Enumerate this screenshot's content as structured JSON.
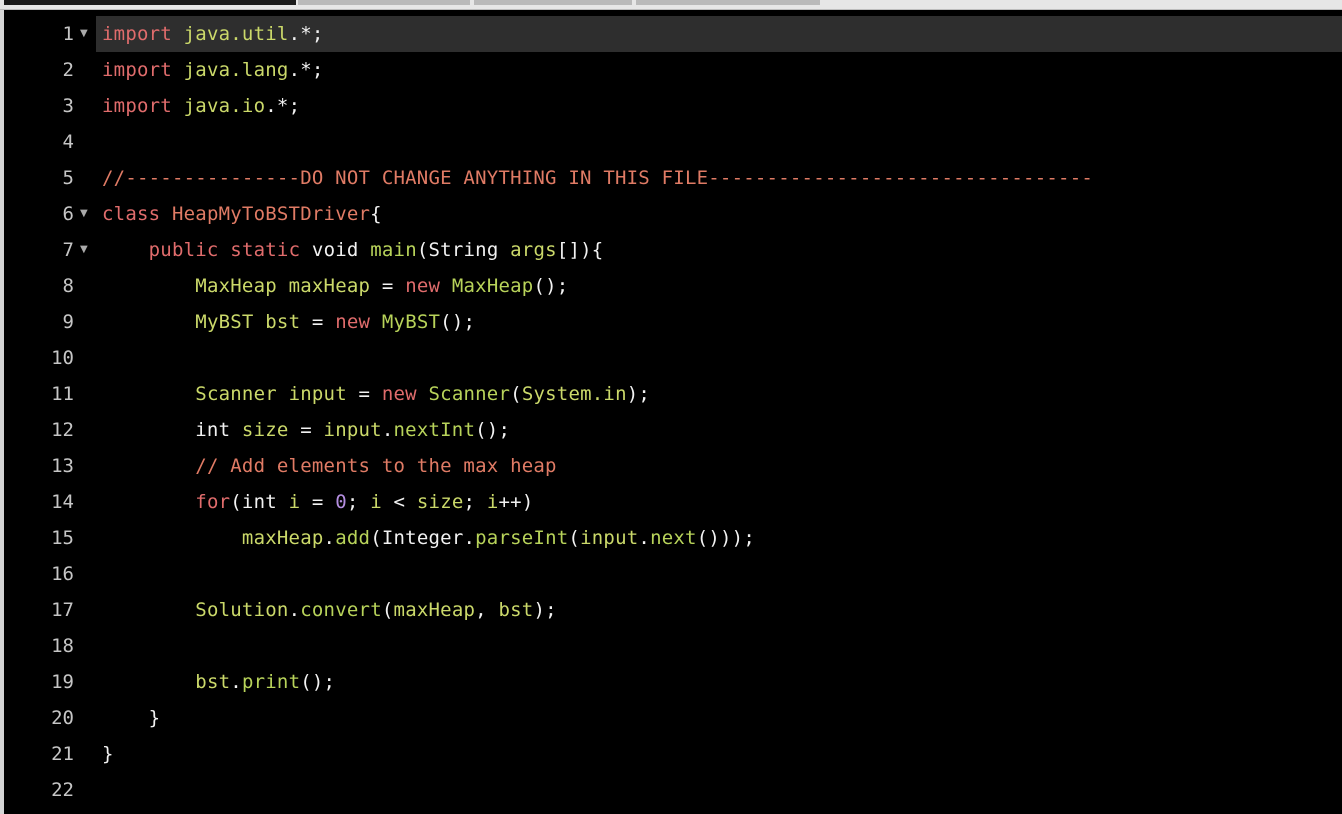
{
  "editor": {
    "language": "java",
    "active_line": 1,
    "colors": {
      "background": "#000000",
      "keyword": "#e06c6c",
      "type": "#cbd96a",
      "function": "#b8d35a",
      "comment": "#e07b65",
      "number": "#b48ee0",
      "text": "#f2f2f2",
      "gutter": "#c6c6c6",
      "active_line_bg": "#2e2e2e"
    },
    "lines": [
      {
        "number": "1",
        "fold": "▼",
        "tokens": [
          {
            "t": "import",
            "c": "kw"
          },
          {
            "t": " ",
            "c": "pl"
          },
          {
            "t": "java.util",
            "c": "ty"
          },
          {
            "t": ".*;",
            "c": "pl"
          }
        ]
      },
      {
        "number": "2",
        "fold": "",
        "tokens": [
          {
            "t": "import",
            "c": "kw"
          },
          {
            "t": " ",
            "c": "pl"
          },
          {
            "t": "java.lang",
            "c": "ty"
          },
          {
            "t": ".*;",
            "c": "pl"
          }
        ]
      },
      {
        "number": "3",
        "fold": "",
        "tokens": [
          {
            "t": "import",
            "c": "kw"
          },
          {
            "t": " ",
            "c": "pl"
          },
          {
            "t": "java.io",
            "c": "ty"
          },
          {
            "t": ".*;",
            "c": "pl"
          }
        ]
      },
      {
        "number": "4",
        "fold": "",
        "tokens": []
      },
      {
        "number": "5",
        "fold": "",
        "tokens": [
          {
            "t": "//---------------DO NOT CHANGE ANYTHING IN THIS FILE---------------------------------",
            "c": "cm"
          }
        ]
      },
      {
        "number": "6",
        "fold": "▼",
        "tokens": [
          {
            "t": "class",
            "c": "kw"
          },
          {
            "t": " ",
            "c": "pl"
          },
          {
            "t": "HeapMyToBSTDriver",
            "c": "cm"
          },
          {
            "t": "{",
            "c": "pl"
          }
        ]
      },
      {
        "number": "7",
        "fold": "▼",
        "tokens": [
          {
            "t": "    ",
            "c": "pl"
          },
          {
            "t": "public",
            "c": "kw"
          },
          {
            "t": " ",
            "c": "pl"
          },
          {
            "t": "static",
            "c": "kw"
          },
          {
            "t": " void ",
            "c": "pl"
          },
          {
            "t": "main",
            "c": "fn"
          },
          {
            "t": "(String ",
            "c": "pl"
          },
          {
            "t": "args",
            "c": "ty"
          },
          {
            "t": "[]){",
            "c": "pl"
          }
        ]
      },
      {
        "number": "8",
        "fold": "",
        "tokens": [
          {
            "t": "        ",
            "c": "pl"
          },
          {
            "t": "MaxHeap",
            "c": "ty"
          },
          {
            "t": " ",
            "c": "pl"
          },
          {
            "t": "maxHeap",
            "c": "ty"
          },
          {
            "t": " = ",
            "c": "pl"
          },
          {
            "t": "new",
            "c": "kw"
          },
          {
            "t": " ",
            "c": "pl"
          },
          {
            "t": "MaxHeap",
            "c": "fn"
          },
          {
            "t": "();",
            "c": "pl"
          }
        ]
      },
      {
        "number": "9",
        "fold": "",
        "tokens": [
          {
            "t": "        ",
            "c": "pl"
          },
          {
            "t": "MyBST",
            "c": "ty"
          },
          {
            "t": " ",
            "c": "pl"
          },
          {
            "t": "bst",
            "c": "ty"
          },
          {
            "t": " = ",
            "c": "pl"
          },
          {
            "t": "new",
            "c": "kw"
          },
          {
            "t": " ",
            "c": "pl"
          },
          {
            "t": "MyBST",
            "c": "fn"
          },
          {
            "t": "();",
            "c": "pl"
          }
        ]
      },
      {
        "number": "10",
        "fold": "",
        "tokens": []
      },
      {
        "number": "11",
        "fold": "",
        "tokens": [
          {
            "t": "        ",
            "c": "pl"
          },
          {
            "t": "Scanner",
            "c": "ty"
          },
          {
            "t": " ",
            "c": "pl"
          },
          {
            "t": "input",
            "c": "ty"
          },
          {
            "t": " = ",
            "c": "pl"
          },
          {
            "t": "new",
            "c": "kw"
          },
          {
            "t": " ",
            "c": "pl"
          },
          {
            "t": "Scanner",
            "c": "fn"
          },
          {
            "t": "(",
            "c": "pl"
          },
          {
            "t": "System.in",
            "c": "ty"
          },
          {
            "t": ");",
            "c": "pl"
          }
        ]
      },
      {
        "number": "12",
        "fold": "",
        "tokens": [
          {
            "t": "        int ",
            "c": "pl"
          },
          {
            "t": "size",
            "c": "ty"
          },
          {
            "t": " = ",
            "c": "pl"
          },
          {
            "t": "input",
            "c": "ty"
          },
          {
            "t": ".",
            "c": "pl"
          },
          {
            "t": "nextInt",
            "c": "fn"
          },
          {
            "t": "();",
            "c": "pl"
          }
        ]
      },
      {
        "number": "13",
        "fold": "",
        "tokens": [
          {
            "t": "        ",
            "c": "pl"
          },
          {
            "t": "// Add elements to the max heap",
            "c": "cm"
          }
        ]
      },
      {
        "number": "14",
        "fold": "",
        "tokens": [
          {
            "t": "        ",
            "c": "pl"
          },
          {
            "t": "for",
            "c": "kw"
          },
          {
            "t": "(int ",
            "c": "pl"
          },
          {
            "t": "i",
            "c": "ty"
          },
          {
            "t": " = ",
            "c": "pl"
          },
          {
            "t": "0",
            "c": "nm"
          },
          {
            "t": "; ",
            "c": "pl"
          },
          {
            "t": "i",
            "c": "ty"
          },
          {
            "t": " < ",
            "c": "pl"
          },
          {
            "t": "size",
            "c": "ty"
          },
          {
            "t": "; ",
            "c": "pl"
          },
          {
            "t": "i",
            "c": "ty"
          },
          {
            "t": "++)",
            "c": "pl"
          }
        ]
      },
      {
        "number": "15",
        "fold": "",
        "tokens": [
          {
            "t": "            ",
            "c": "pl"
          },
          {
            "t": "maxHeap",
            "c": "ty"
          },
          {
            "t": ".",
            "c": "pl"
          },
          {
            "t": "add",
            "c": "fn"
          },
          {
            "t": "(Integer.",
            "c": "pl"
          },
          {
            "t": "parseInt",
            "c": "fn"
          },
          {
            "t": "(",
            "c": "pl"
          },
          {
            "t": "input",
            "c": "ty"
          },
          {
            "t": ".",
            "c": "pl"
          },
          {
            "t": "next",
            "c": "fn"
          },
          {
            "t": "()));",
            "c": "pl"
          }
        ]
      },
      {
        "number": "16",
        "fold": "",
        "tokens": []
      },
      {
        "number": "17",
        "fold": "",
        "tokens": [
          {
            "t": "        ",
            "c": "pl"
          },
          {
            "t": "Solution",
            "c": "ty"
          },
          {
            "t": ".",
            "c": "pl"
          },
          {
            "t": "convert",
            "c": "fn"
          },
          {
            "t": "(",
            "c": "pl"
          },
          {
            "t": "maxHeap",
            "c": "ty"
          },
          {
            "t": ", ",
            "c": "pl"
          },
          {
            "t": "bst",
            "c": "ty"
          },
          {
            "t": ");",
            "c": "pl"
          }
        ]
      },
      {
        "number": "18",
        "fold": "",
        "tokens": []
      },
      {
        "number": "19",
        "fold": "",
        "tokens": [
          {
            "t": "        ",
            "c": "pl"
          },
          {
            "t": "bst",
            "c": "ty"
          },
          {
            "t": ".",
            "c": "pl"
          },
          {
            "t": "print",
            "c": "fn"
          },
          {
            "t": "();",
            "c": "pl"
          }
        ]
      },
      {
        "number": "20",
        "fold": "",
        "tokens": [
          {
            "t": "    }",
            "c": "pl"
          }
        ]
      },
      {
        "number": "21",
        "fold": "",
        "tokens": [
          {
            "t": "}",
            "c": "pl"
          }
        ]
      },
      {
        "number": "22",
        "fold": "",
        "tokens": []
      }
    ]
  }
}
